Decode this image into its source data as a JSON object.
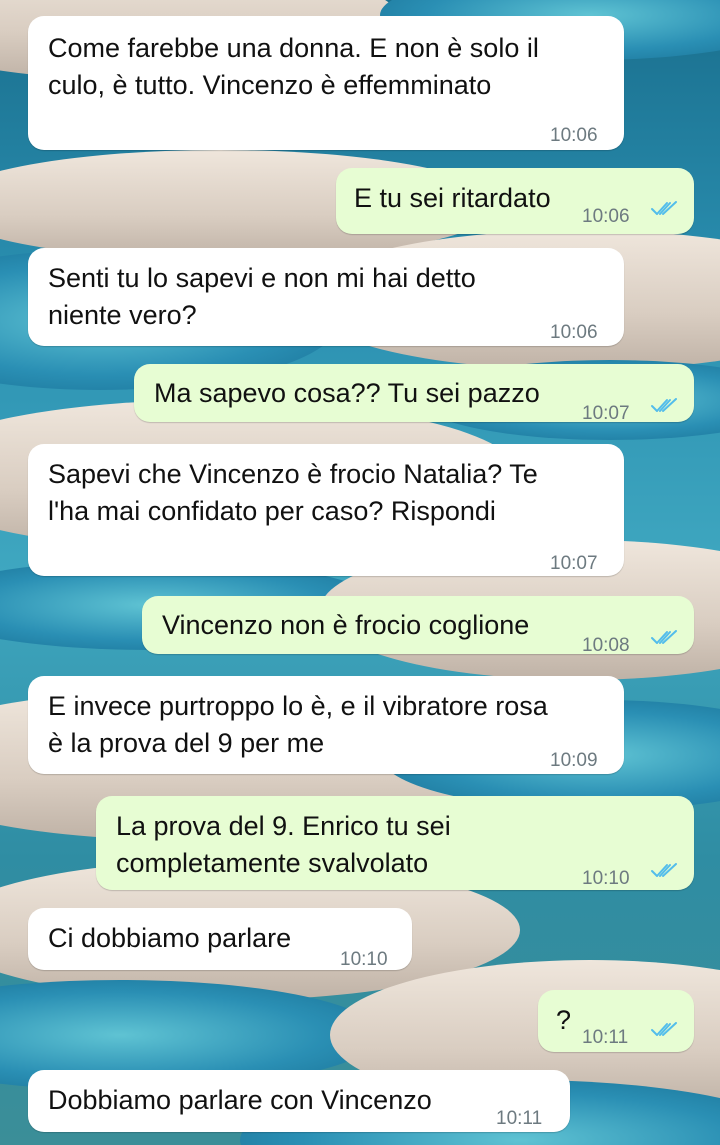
{
  "chat": {
    "messages": [
      {
        "dir": "in",
        "lines": [
          "Come farebbe una donna. E non è solo il",
          "culo, è tutto. Vincenzo è effemminato"
        ],
        "time": "10:06"
      },
      {
        "dir": "out",
        "lines": [
          "E tu sei ritardato"
        ],
        "time": "10:06",
        "status": "read"
      },
      {
        "dir": "in",
        "lines": [
          "Senti tu lo sapevi e non mi hai detto",
          "niente vero?"
        ],
        "time": "10:06"
      },
      {
        "dir": "out",
        "lines": [
          "Ma sapevo cosa?? Tu sei pazzo"
        ],
        "time": "10:07",
        "status": "read"
      },
      {
        "dir": "in",
        "lines": [
          "Sapevi che Vincenzo è frocio Natalia? Te",
          "l'ha mai confidato per caso? Rispondi"
        ],
        "time": "10:07"
      },
      {
        "dir": "out",
        "lines": [
          "Vincenzo non è frocio coglione"
        ],
        "time": "10:08",
        "status": "read"
      },
      {
        "dir": "in",
        "lines": [
          "E invece purtroppo lo è, e il vibratore rosa",
          "è la prova del 9 per me"
        ],
        "time": "10:09"
      },
      {
        "dir": "out",
        "lines": [
          "La prova del 9. Enrico tu sei",
          "completamente svalvolato"
        ],
        "time": "10:10",
        "status": "read"
      },
      {
        "dir": "in",
        "lines": [
          "Ci dobbiamo parlare"
        ],
        "time": "10:10"
      },
      {
        "dir": "out",
        "lines": [
          "?"
        ],
        "time": "10:11",
        "status": "read"
      },
      {
        "dir": "in",
        "lines": [
          "Dobbiamo parlare con Vincenzo"
        ],
        "time": "10:11"
      }
    ]
  },
  "colors": {
    "incoming_bubble": "#ffffff",
    "outgoing_bubble": "#e7fdd3",
    "read_ticks": "#53bdeb",
    "timestamp": "#6d7a80"
  },
  "icons": {
    "read_status": "double-check-icon"
  }
}
